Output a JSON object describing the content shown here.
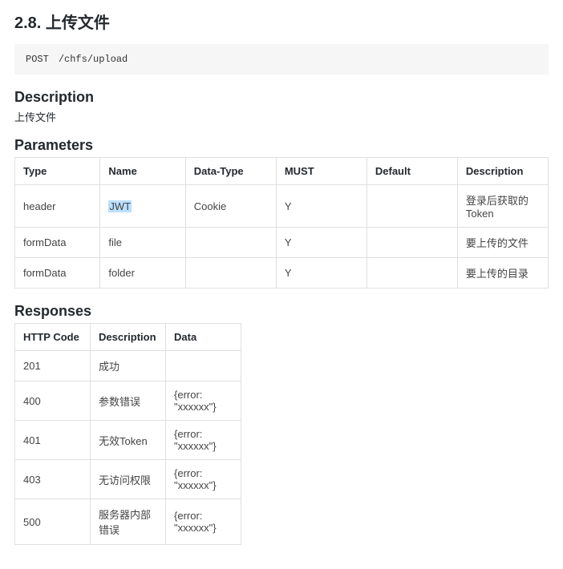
{
  "title": "2.8. 上传文件",
  "endpoint": {
    "method": "POST",
    "path": "/chfs/upload"
  },
  "sections": {
    "description_heading": "Description",
    "description_text": "上传文件",
    "parameters_heading": "Parameters",
    "responses_heading": "Responses"
  },
  "parameters": {
    "headers": [
      "Type",
      "Name",
      "Data-Type",
      "MUST",
      "Default",
      "Description"
    ],
    "rows": [
      {
        "type": "header",
        "name": "JWT",
        "datatype": "Cookie",
        "must": "Y",
        "default": "",
        "description": "登录后获取的Token",
        "name_highlight": true
      },
      {
        "type": "formData",
        "name": "file",
        "datatype": "",
        "must": "Y",
        "default": "",
        "description": "要上传的文件"
      },
      {
        "type": "formData",
        "name": "folder",
        "datatype": "",
        "must": "Y",
        "default": "",
        "description": "要上传的目录"
      }
    ]
  },
  "responses": {
    "headers": [
      "HTTP Code",
      "Description",
      "Data"
    ],
    "rows": [
      {
        "code": "201",
        "description": "成功",
        "data": ""
      },
      {
        "code": "400",
        "description": "参数错误",
        "data": "{error: \"xxxxxx\"}"
      },
      {
        "code": "401",
        "description": "无效Token",
        "data": "{error: \"xxxxxx\"}"
      },
      {
        "code": "403",
        "description": "无访问权限",
        "data": "{error: \"xxxxxx\"}"
      },
      {
        "code": "500",
        "description": "服务器内部错误",
        "data": "{error: \"xxxxxx\"}"
      }
    ]
  }
}
